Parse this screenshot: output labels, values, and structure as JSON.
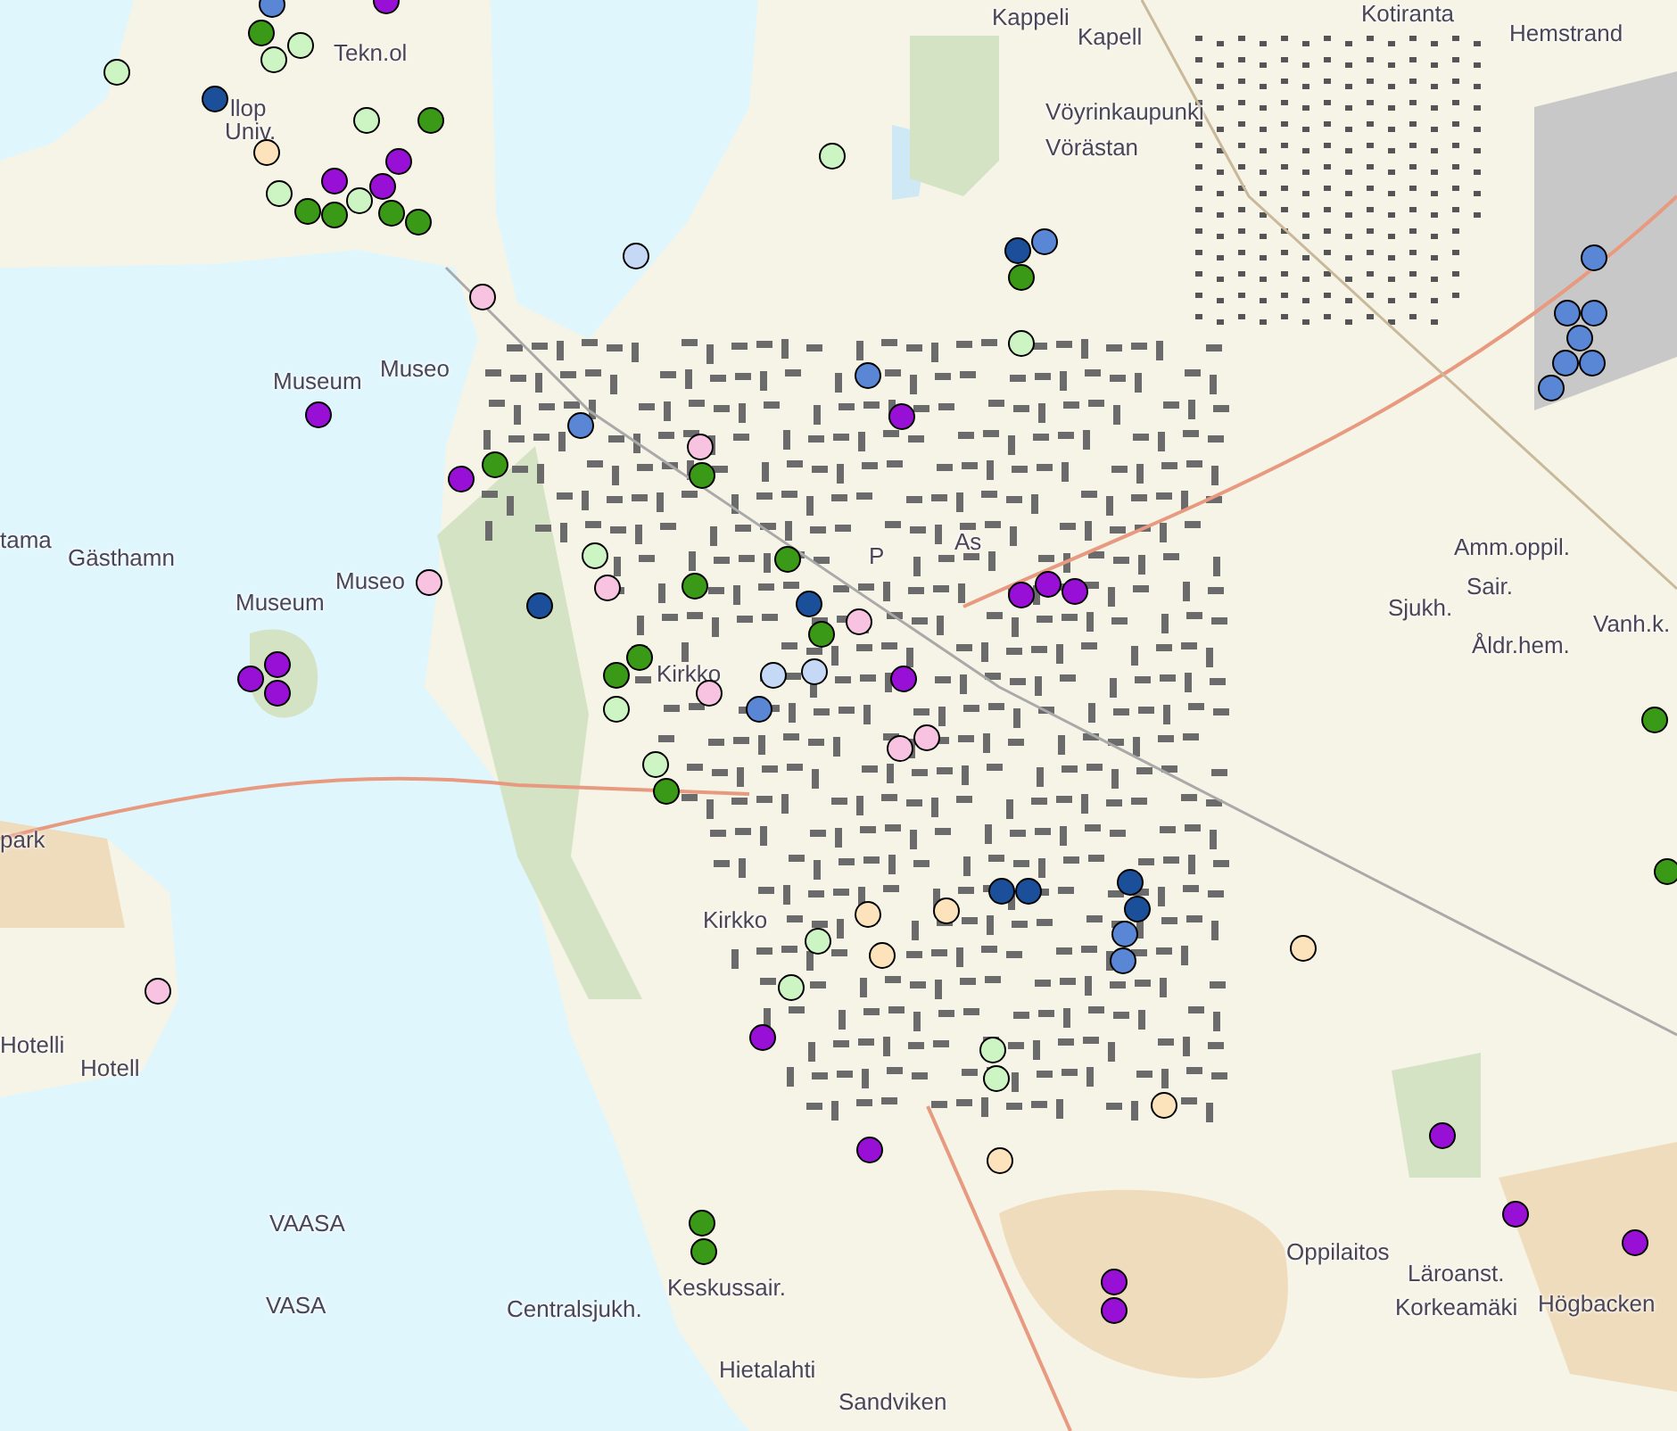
{
  "map": {
    "labels": [
      {
        "text": "Tekn.ol"
      },
      {
        "text": "llop"
      },
      {
        "text": "Univ."
      },
      {
        "text": "Kappeli"
      },
      {
        "text": "Kapell"
      },
      {
        "text": "Kotiranta"
      },
      {
        "text": "Hemstrand"
      },
      {
        "text": "Vöyrinkaupunki"
      },
      {
        "text": "Vörästan"
      },
      {
        "text": "Museum"
      },
      {
        "text": "Museo"
      },
      {
        "text": "tama"
      },
      {
        "text": "Gästhamn"
      },
      {
        "text": "Museum"
      },
      {
        "text": "Museo"
      },
      {
        "text": "P"
      },
      {
        "text": "As"
      },
      {
        "text": "Amm.oppil."
      },
      {
        "text": "Sair."
      },
      {
        "text": "Sjukh."
      },
      {
        "text": "Åldr.hem."
      },
      {
        "text": "Vanh.k."
      },
      {
        "text": "Kirkko"
      },
      {
        "text": "park"
      },
      {
        "text": "Kirkko"
      },
      {
        "text": "Hotelli"
      },
      {
        "text": "Hotell"
      },
      {
        "text": "VAASA"
      },
      {
        "text": "VASA"
      },
      {
        "text": "Keskussair."
      },
      {
        "text": "Centralsjukh."
      },
      {
        "text": "Hietalahti"
      },
      {
        "text": "Sandviken"
      },
      {
        "text": "Oppilaitos"
      },
      {
        "text": "Läroanst."
      },
      {
        "text": "Korkeamäki"
      },
      {
        "text": "Högbacken"
      }
    ],
    "pins": [
      {
        "color": "#5a86d6"
      },
      {
        "color": "#9810d5"
      },
      {
        "color": "#3a9a17"
      },
      {
        "color": "#cdf5c3"
      },
      {
        "color": "#cdf5c3"
      },
      {
        "color": "#cdf5c3"
      },
      {
        "color": "#1b4f9a"
      },
      {
        "color": "#cdf5c3"
      },
      {
        "color": "#3a9a17"
      },
      {
        "color": "#fce3bb"
      },
      {
        "color": "#9810d5"
      },
      {
        "color": "#cdf5c3"
      },
      {
        "color": "#3a9a17"
      },
      {
        "color": "#3a9a17"
      },
      {
        "color": "#9810d5"
      },
      {
        "color": "#cdf5c3"
      },
      {
        "color": "#9810d5"
      },
      {
        "color": "#3a9a17"
      },
      {
        "color": "#3a9a17"
      },
      {
        "color": "#c5d9f7"
      },
      {
        "color": "#f7c3e0"
      },
      {
        "color": "#9810d5"
      },
      {
        "color": "#5a86d6"
      },
      {
        "color": "#3a9a17"
      },
      {
        "color": "#9810d5"
      },
      {
        "color": "#3a9a17"
      },
      {
        "color": "#f7c3e0"
      },
      {
        "color": "#cdf5c3"
      },
      {
        "color": "#f7c3e0"
      },
      {
        "color": "#3a9a17"
      },
      {
        "color": "#f7c3e0"
      },
      {
        "color": "#1b4f9a"
      },
      {
        "color": "#3a9a17"
      },
      {
        "color": "#1b4f9a"
      },
      {
        "color": "#3a9a17"
      },
      {
        "color": "#f7c3e0"
      },
      {
        "color": "#3a9a17"
      },
      {
        "color": "#3a9a17"
      },
      {
        "color": "#c5d9f7"
      },
      {
        "color": "#c5d9f7"
      },
      {
        "color": "#f7c3e0"
      },
      {
        "color": "#5a86d6"
      },
      {
        "color": "#cdf5c3"
      },
      {
        "color": "#9810d5"
      },
      {
        "color": "#9810d5"
      },
      {
        "color": "#9810d5"
      },
      {
        "color": "#cdf5c3"
      },
      {
        "color": "#5a86d6"
      },
      {
        "color": "#1b4f9a"
      },
      {
        "color": "#3a9a17"
      },
      {
        "color": "#cdf5c3"
      },
      {
        "color": "#5a86d6"
      },
      {
        "color": "#9810d5"
      },
      {
        "color": "#5a86d6"
      },
      {
        "color": "#5a86d6"
      },
      {
        "color": "#5a86d6"
      },
      {
        "color": "#5a86d6"
      },
      {
        "color": "#5a86d6"
      },
      {
        "color": "#5a86d6"
      },
      {
        "color": "#5a86d6"
      },
      {
        "color": "#9810d5"
      },
      {
        "color": "#9810d5"
      },
      {
        "color": "#9810d5"
      },
      {
        "color": "#9810d5"
      },
      {
        "color": "#3a9a17"
      },
      {
        "color": "#cdf5c3"
      },
      {
        "color": "#3a9a17"
      },
      {
        "color": "#cdf5c3"
      },
      {
        "color": "#cdf5c3"
      },
      {
        "color": "#9810d5"
      },
      {
        "color": "#f7c3e0"
      },
      {
        "color": "#3a9a17"
      },
      {
        "color": "#3a9a17"
      },
      {
        "color": "#f7c3e0"
      },
      {
        "color": "#f7c3e0"
      },
      {
        "color": "#1b4f9a"
      },
      {
        "color": "#1b4f9a"
      },
      {
        "color": "#fce3bb"
      },
      {
        "color": "#fce3bb"
      },
      {
        "color": "#fce3bb"
      },
      {
        "color": "#1b4f9a"
      },
      {
        "color": "#1b4f9a"
      },
      {
        "color": "#5a86d6"
      },
      {
        "color": "#5a86d6"
      },
      {
        "color": "#fce3bb"
      },
      {
        "color": "#cdf5c3"
      },
      {
        "color": "#cdf5c3"
      },
      {
        "color": "#fce3bb"
      },
      {
        "color": "#fce3bb"
      },
      {
        "color": "#9810d5"
      },
      {
        "color": "#9810d5"
      },
      {
        "color": "#9810d5"
      },
      {
        "color": "#9810d5"
      },
      {
        "color": "#9810d5"
      },
      {
        "color": "#9810d5"
      },
      {
        "color": "#3a9a17"
      }
    ]
  }
}
